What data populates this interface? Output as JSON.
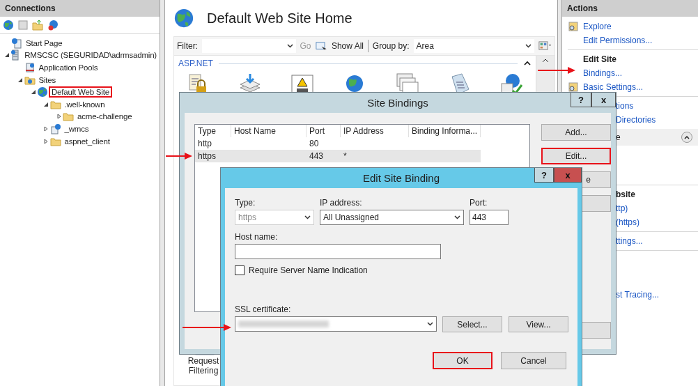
{
  "connections": {
    "title": "Connections",
    "tree": [
      {
        "label": "Start Page",
        "kind": "page",
        "highlighted": false
      },
      {
        "label": "RMSCSC (SEGURIDAD\\adrmsadmin)",
        "kind": "server",
        "expanded": true,
        "highlighted": false,
        "children": [
          {
            "label": "Application Pools",
            "kind": "pool",
            "highlighted": false
          },
          {
            "label": "Sites",
            "kind": "sites",
            "expanded": true,
            "highlighted": false,
            "children": [
              {
                "label": "Default Web Site",
                "kind": "globe",
                "expanded": true,
                "highlighted": true,
                "children": [
                  {
                    "label": ".well-known",
                    "kind": "folder",
                    "expanded": true,
                    "highlighted": false,
                    "children": [
                      {
                        "label": "acme-challenge",
                        "kind": "folder",
                        "expanded": false,
                        "highlighted": false
                      }
                    ]
                  },
                  {
                    "label": "_wmcs",
                    "kind": "app",
                    "expanded": false,
                    "highlighted": false
                  },
                  {
                    "label": "aspnet_client",
                    "kind": "folder",
                    "expanded": false,
                    "highlighted": false
                  }
                ]
              }
            ]
          }
        ]
      }
    ]
  },
  "home": {
    "title": "Default Web Site Home",
    "filter": {
      "label": "Filter:",
      "go": "Go",
      "go_disabled": true,
      "show_all": "Show All",
      "group_by_label": "Group by:",
      "group_by": "Area"
    },
    "group": {
      "title": "ASP.NET",
      "expanded": true,
      "icons": [
        {
          "kind": "lock"
        },
        {
          "kind": "download"
        },
        {
          "kind": "error"
        },
        {
          "kind": "globe"
        },
        {
          "kind": "pages"
        },
        {
          "kind": "tag"
        },
        {
          "kind": "check"
        }
      ]
    },
    "feature": "Request Filtering"
  },
  "actions": {
    "title": "Actions",
    "items": [
      {
        "kind": "link",
        "label": "Explore",
        "icon": true
      },
      {
        "kind": "link",
        "label": "Edit Permissions..."
      },
      {
        "kind": "divider"
      },
      {
        "kind": "heading",
        "label": "Edit Site"
      },
      {
        "kind": "link",
        "label": "Bindings..."
      },
      {
        "kind": "link",
        "label": "Basic Settings...",
        "icon": true
      },
      {
        "kind": "divider"
      },
      {
        "kind": "partial-link",
        "label": "tions"
      },
      {
        "kind": "partial-link",
        "label": "Directories"
      },
      {
        "kind": "group",
        "label": "e",
        "expanded": true
      },
      {
        "kind": "spacer"
      },
      {
        "kind": "divider"
      },
      {
        "kind": "partial-heading",
        "label": "bsite"
      },
      {
        "kind": "partial-link",
        "label": "ttp)"
      },
      {
        "kind": "partial-link",
        "label": "(https)"
      },
      {
        "kind": "divider"
      },
      {
        "kind": "partial-link",
        "label": "ttings..."
      },
      {
        "kind": "divider"
      },
      {
        "kind": "spacer"
      },
      {
        "kind": "partial-link",
        "label": "st Tracing..."
      }
    ]
  },
  "site_bindings": {
    "title": "Site Bindings",
    "help": "?",
    "close": "x",
    "columns": [
      "Type",
      "Host Name",
      "Port",
      "IP Address",
      "Binding Informa..."
    ],
    "rows": [
      {
        "cells": [
          "http",
          "",
          "80",
          "",
          ""
        ],
        "selected": false
      },
      {
        "cells": [
          "https",
          "",
          "443",
          "*",
          ""
        ],
        "selected": true
      }
    ],
    "buttons": [
      {
        "label": "Add...",
        "highlighted": false
      },
      {
        "label": "Edit...",
        "highlighted": true
      },
      {
        "label": "e",
        "highlighted": false
      },
      {
        "highlighted": false
      }
    ]
  },
  "edit_binding": {
    "title": "Edit Site Binding",
    "help": "?",
    "close": "x",
    "type": {
      "label": "Type:",
      "value": "https",
      "disabled": true
    },
    "ip": {
      "label": "IP address:",
      "value": "All Unassigned",
      "disabled": false
    },
    "port": {
      "label": "Port:",
      "value": "443"
    },
    "host": {
      "label": "Host name:"
    },
    "sni": {
      "label": "Require Server Name Indication",
      "checked": false
    },
    "ssl": {
      "label": "SSL certificate:",
      "redacted": true
    },
    "side_buttons": [
      "Select...",
      "View..."
    ],
    "buttons": [
      {
        "label": "OK",
        "highlighted": true
      },
      {
        "label": "Cancel",
        "highlighted": false
      }
    ]
  }
}
